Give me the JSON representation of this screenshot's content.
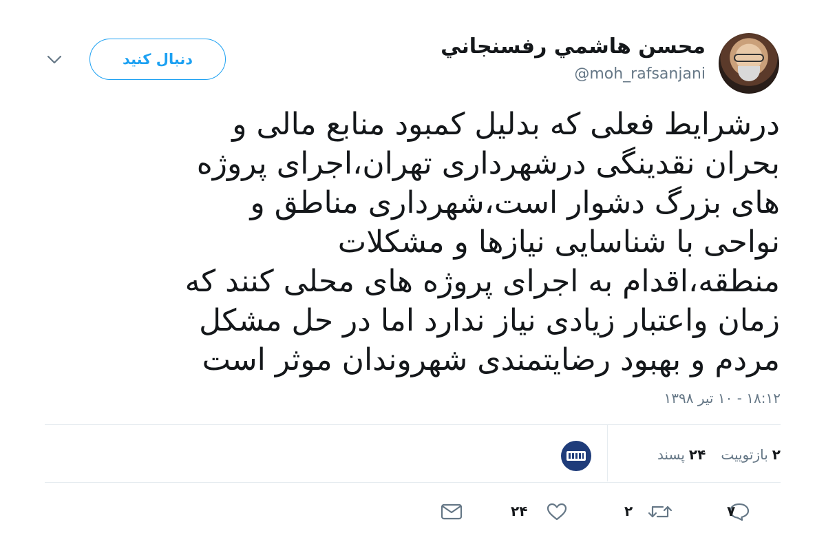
{
  "header": {
    "display_name": "محسن هاشمي رفسنجاني",
    "handle": "@moh_rafsanjani",
    "follow_label": "دنبال کنید"
  },
  "tweet": {
    "lines": [
      "درشرایط فعلی که بدلیل کمبود منابع مالی و",
      "بحران نقدینگی درشهرداری تهران،اجرای پروژه",
      "های بزرگ دشوار است،شهرداری مناطق و",
      "نواحی با شناسایی نیازها و مشکلات",
      "منطقه،اقدام به اجرای پروژه های محلی کنند که",
      "زمان واعتبار زیادی نیاز ندارد اما در حل مشکل",
      "مردم و بهبود رضایتمندی شهروندان موثر است"
    ],
    "timestamp": "۱۸:۱۲ - ۱۰ تیر ۱۳۹۸"
  },
  "stats": {
    "retweets_count": "۲",
    "retweets_label": "بازتوییت",
    "likes_count": "۲۴",
    "likes_label": "پسند"
  },
  "actions": {
    "reply_count": "۷",
    "retweet_count": "۲",
    "like_count": "۲۴"
  },
  "icons": {
    "reply": "reply-icon",
    "retweet": "retweet-icon",
    "like": "heart-icon",
    "dm": "envelope-icon",
    "more": "chevron-down-icon"
  },
  "colors": {
    "accent": "#1da1f2",
    "muted": "#657786",
    "text": "#14171a",
    "divider": "#e6ecf0"
  }
}
